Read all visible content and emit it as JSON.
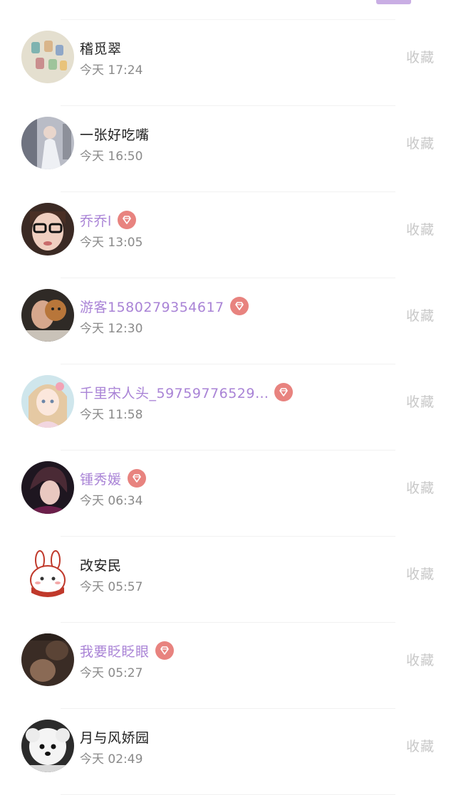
{
  "visitors": [
    {
      "name": "稽觅翠",
      "time": "今天 17:24",
      "vip": false,
      "avatar": "avatar-spools",
      "favorite_label": "收藏"
    },
    {
      "name": "一张好吃嘴",
      "time": "今天 16:50",
      "vip": false,
      "avatar": "avatar-girl-dress",
      "favorite_label": "收藏"
    },
    {
      "name": "乔乔l",
      "time": "今天 13:05",
      "vip": true,
      "avatar": "avatar-girl-glasses",
      "favorite_label": "收藏"
    },
    {
      "name": "游客1580279354617",
      "time": "今天 12:30",
      "vip": true,
      "avatar": "avatar-dog",
      "favorite_label": "收藏"
    },
    {
      "name": "千里宋人头_59759776529…",
      "time": "今天 11:58",
      "vip": true,
      "avatar": "avatar-anime-girl",
      "favorite_label": "收藏"
    },
    {
      "name": "锺秀媛",
      "time": "今天 06:34",
      "vip": true,
      "avatar": "avatar-anime-boy",
      "favorite_label": "收藏"
    },
    {
      "name": "改安民",
      "time": "今天 05:57",
      "vip": false,
      "avatar": "avatar-bunny",
      "favorite_label": "收藏"
    },
    {
      "name": "我要眨眨眼",
      "time": "今天 05:27",
      "vip": true,
      "avatar": "avatar-dark-photo",
      "favorite_label": "收藏"
    },
    {
      "name": "月与风娇园",
      "time": "今天 02:49",
      "vip": false,
      "avatar": "avatar-white-dog",
      "favorite_label": "收藏"
    }
  ],
  "icons": {
    "vip_badge": "diamond-icon"
  },
  "colors": {
    "vip_name": "#a983d6",
    "badge": "#e8837f",
    "indicator": "#c9aee4",
    "favorite": "#c8c8c8"
  }
}
